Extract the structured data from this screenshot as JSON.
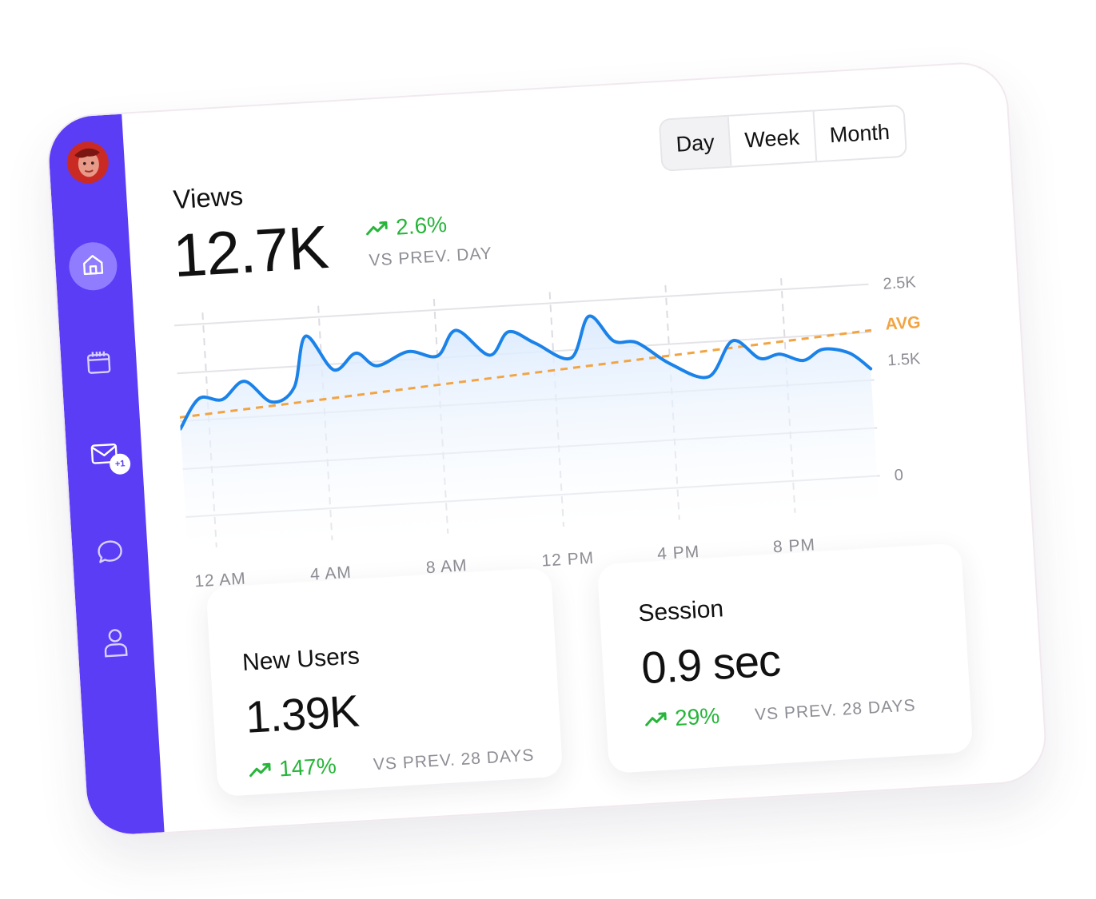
{
  "sidebar": {
    "avatar": "user-avatar",
    "items": [
      {
        "name": "home",
        "icon": "home-icon",
        "active": true
      },
      {
        "name": "calendar",
        "icon": "calendar-icon",
        "active": false
      },
      {
        "name": "mail",
        "icon": "mail-icon",
        "active": false,
        "badge": "+1"
      },
      {
        "name": "chat",
        "icon": "chat-bubble-icon",
        "active": false
      },
      {
        "name": "profile",
        "icon": "user-icon",
        "active": false
      }
    ]
  },
  "period_selector": {
    "options": [
      "Day",
      "Week",
      "Month"
    ],
    "selected": "Day"
  },
  "views": {
    "title": "Views",
    "value": "12.7K",
    "change": "2.6%",
    "comparison": "VS PREV. DAY"
  },
  "chart_data": {
    "type": "area",
    "x": [
      "12 AM",
      "4 AM",
      "8 AM",
      "12 PM",
      "4 PM",
      "8 PM"
    ],
    "y_ticks": [
      "2.5K",
      "1.5K",
      "0"
    ],
    "ylim": [
      0,
      2500
    ],
    "avg_label": "AVG",
    "avg_line": [
      1300,
      1900
    ],
    "series": [
      {
        "hours": [
          0,
          0.7,
          1.5,
          2.3,
          3.2,
          4.0,
          4.5,
          5.4,
          6.2,
          6.9,
          8.0,
          9.0,
          9.7,
          10.8,
          11.5,
          12.4,
          13.6,
          14.3,
          15.1,
          15.9,
          17.0,
          18.3,
          19.2,
          20.1,
          20.8,
          21.6,
          22.3,
          23.2,
          23.9
        ],
        "values": [
          1150,
          1530,
          1500,
          1720,
          1430,
          1600,
          2260,
          1800,
          2000,
          1820,
          1980,
          1900,
          2220,
          1870,
          2160,
          1990,
          1770,
          2300,
          1960,
          1920,
          1620,
          1420,
          1870,
          1620,
          1660,
          1560,
          1690,
          1620,
          1400
        ]
      }
    ],
    "grid": true,
    "colors": {
      "line": "#1a82e8",
      "avg": "#f2a442",
      "fill": "#dbeafd"
    }
  },
  "cards": [
    {
      "label": "New Users",
      "value": "1.39K",
      "change": "147%",
      "comparison": "VS PREV. 28 DAYS"
    },
    {
      "label": "Session",
      "value": "0.9 sec",
      "change": "29%",
      "comparison": "VS PREV. 28 DAYS"
    }
  ],
  "colors": {
    "accent": "#5a3df5",
    "positive": "#27b53a",
    "muted": "#8d8d95"
  }
}
